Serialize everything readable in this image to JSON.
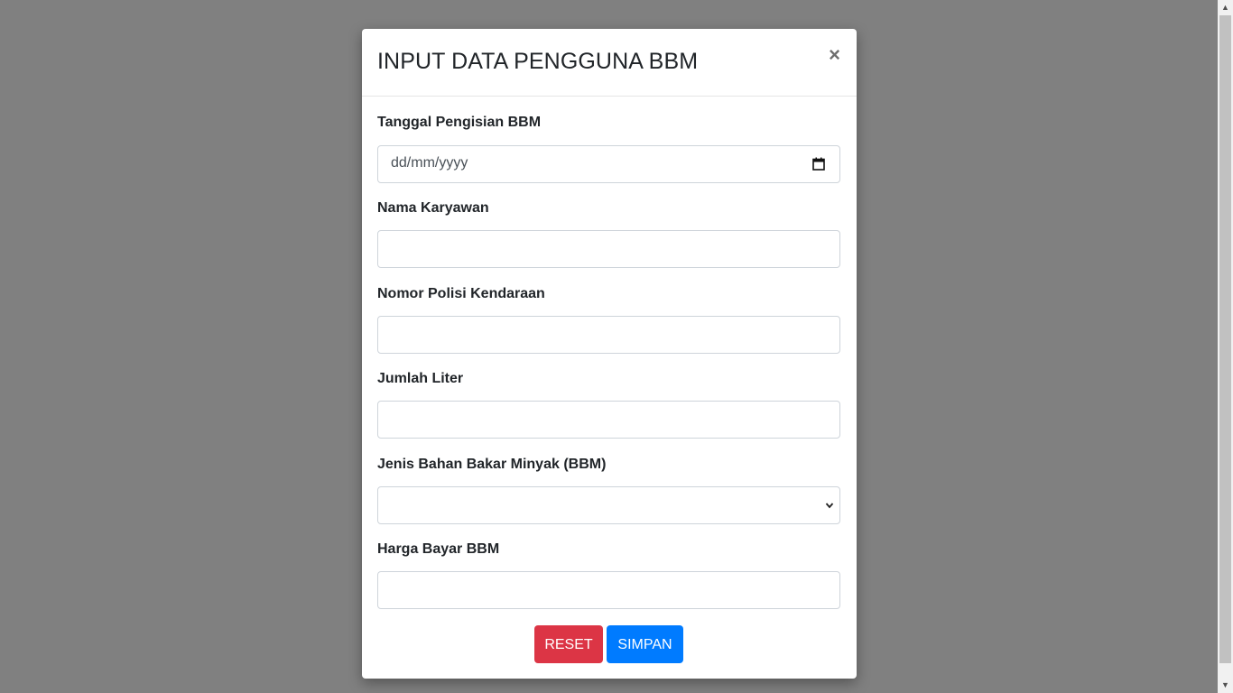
{
  "modal": {
    "title": "INPUT DATA PENGGUNA BBM",
    "close_glyph": "×"
  },
  "form": {
    "fields": [
      {
        "label": "Tanggal Pengisian BBM",
        "type": "date",
        "placeholder": "dd/mm/yyyy",
        "value": ""
      },
      {
        "label": "Nama Karyawan",
        "type": "text",
        "value": ""
      },
      {
        "label": "Nomor Polisi Kendaraan",
        "type": "text",
        "value": ""
      },
      {
        "label": "Jumlah Liter",
        "type": "text",
        "value": ""
      },
      {
        "label": "Jenis Bahan Bakar Minyak (BBM)",
        "type": "select",
        "value": ""
      },
      {
        "label": "Harga Bayar BBM",
        "type": "text",
        "value": ""
      }
    ]
  },
  "buttons": {
    "reset_label": "RESET",
    "save_label": "SIMPAN"
  },
  "colors": {
    "backdrop": "#808080",
    "reset": "#dc3545",
    "save": "#007bff"
  },
  "icons": {
    "close": "close-icon",
    "calendar": "calendar-icon",
    "select_arrow": "chevron-down-icon"
  }
}
